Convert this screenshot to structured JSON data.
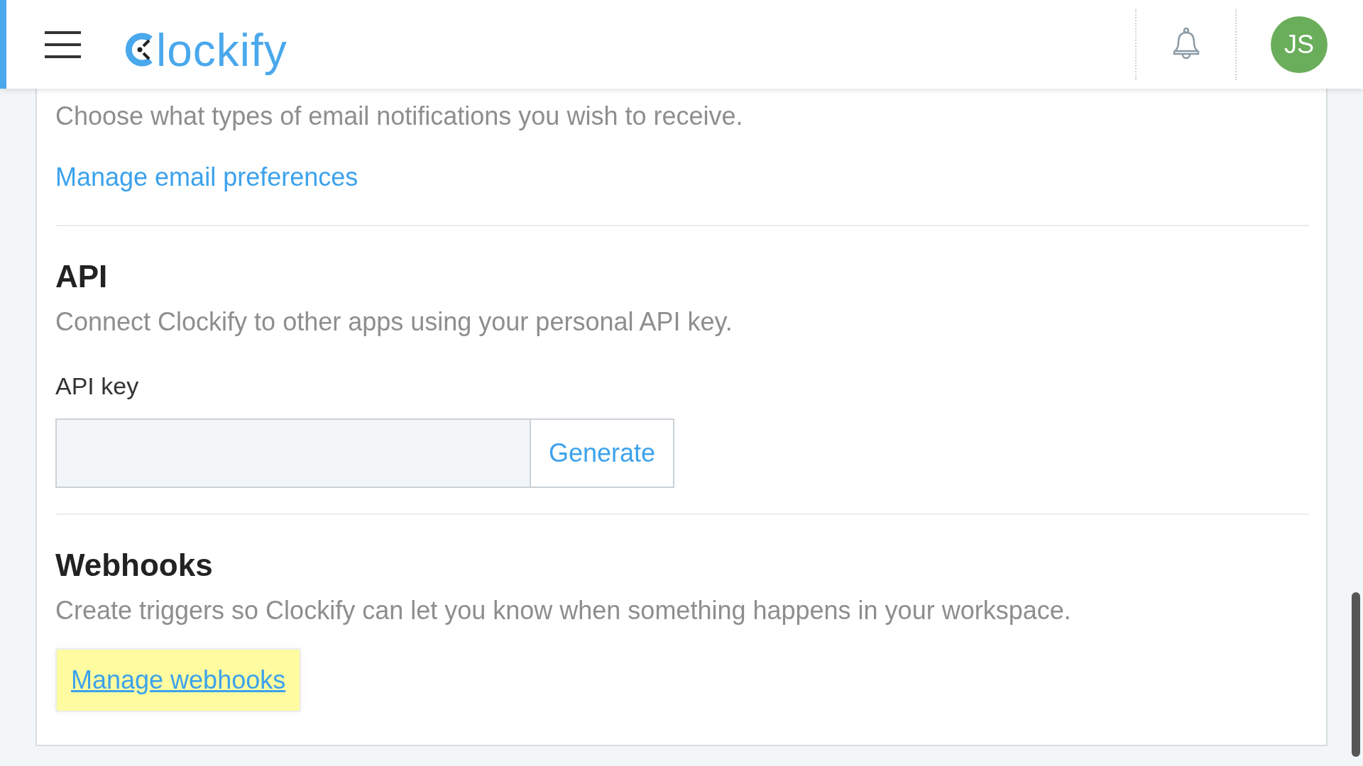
{
  "header": {
    "logo_text": "lockify",
    "avatar_initials": "JS"
  },
  "email_section": {
    "description": "Choose what types of email notifications you wish to receive.",
    "link": "Manage email preferences"
  },
  "api_section": {
    "title": "API",
    "description": "Connect Clockify to other apps using your personal API key.",
    "field_label": "API key",
    "button": "Generate"
  },
  "webhooks_section": {
    "title": "Webhooks",
    "description": "Create triggers so Clockify can let you know when something happens in your workspace.",
    "button": "Manage webhooks"
  }
}
